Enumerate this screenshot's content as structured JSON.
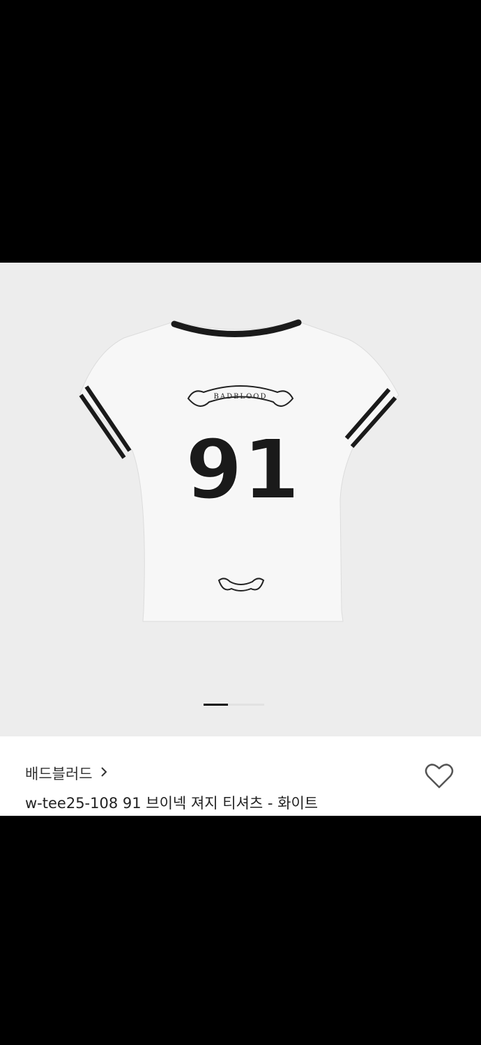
{
  "product": {
    "brand": "배드블러드",
    "title": "w-tee25-108 91 브이넥 져지 티셔츠 - 화이트",
    "image_print": {
      "number": "91",
      "banner_text": "BADBLOOD"
    }
  },
  "carousel": {
    "current": 1,
    "total": 3
  },
  "icons": {
    "brand_chevron": "chevron-right-icon",
    "wishlist": "heart-outline-icon"
  },
  "colors": {
    "background": "#000000",
    "image_bg": "#ededed",
    "panel_bg": "#ffffff",
    "text": "#222222"
  }
}
